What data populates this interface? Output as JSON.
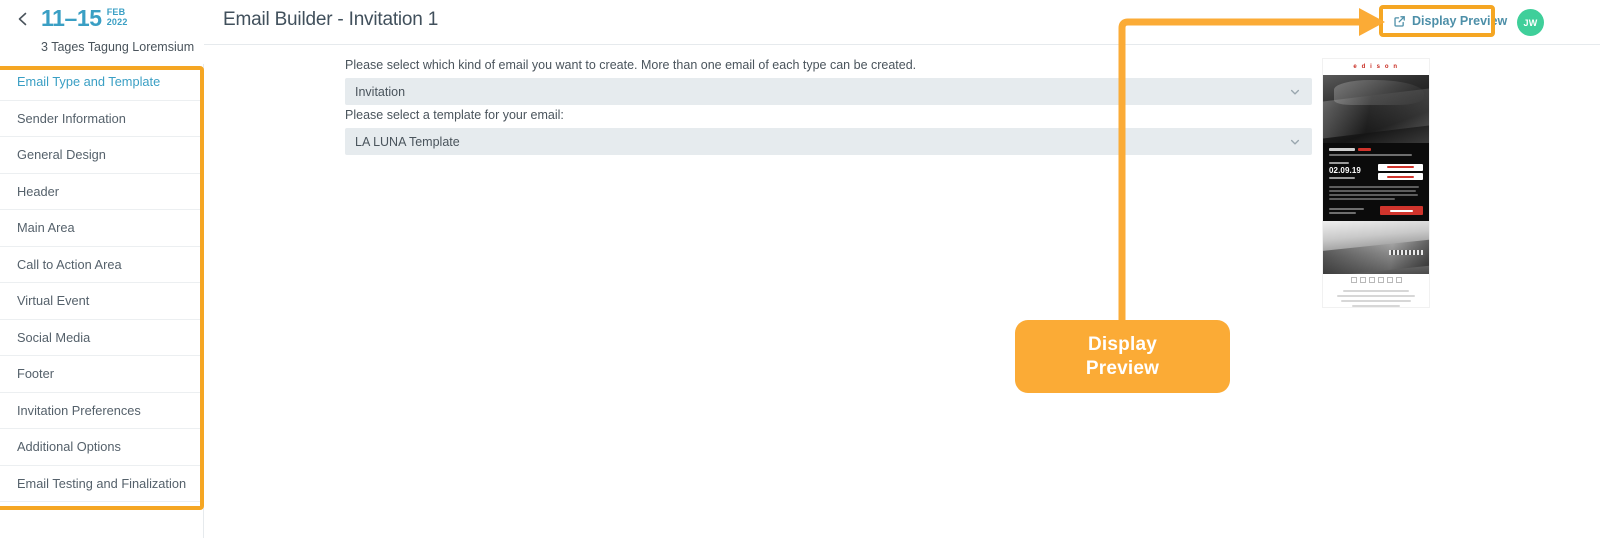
{
  "topbar": {
    "back_icon": "chevron-left-icon",
    "event": {
      "date_range": "11–15",
      "month": "FEB",
      "year": "2022",
      "subtitle": "3 Tages Tagung Loremsium"
    },
    "page_title": "Email Builder - Invitation 1",
    "display_preview": {
      "label": "Display Preview",
      "icon": "external-link-icon"
    },
    "avatar": {
      "initials": "JW",
      "color": "#3fcf9a"
    }
  },
  "sidebar": {
    "items": [
      {
        "label": "Email Type and Template",
        "active": true
      },
      {
        "label": "Sender Information",
        "active": false
      },
      {
        "label": "General Design",
        "active": false
      },
      {
        "label": "Header",
        "active": false
      },
      {
        "label": "Main Area",
        "active": false
      },
      {
        "label": "Call to Action Area",
        "active": false
      },
      {
        "label": "Virtual Event",
        "active": false
      },
      {
        "label": "Social Media",
        "active": false
      },
      {
        "label": "Footer",
        "active": false
      },
      {
        "label": "Invitation Preferences",
        "active": false
      },
      {
        "label": "Additional Options",
        "active": false
      },
      {
        "label": "Email Testing and Finalization",
        "active": false
      }
    ]
  },
  "main": {
    "email_type": {
      "label": "Please select which kind of email you want to create. More than one email of each type can be created.",
      "value": "Invitation",
      "chevron": "chevron-down-icon"
    },
    "template": {
      "label": "Please select a template for your email:",
      "value": "LA LUNA Template",
      "chevron": "chevron-down-icon"
    },
    "preview_thumbnail": {
      "brand": "e d i s o n",
      "date": "02.09.19"
    }
  },
  "annotation": {
    "callout_line1": "Display",
    "callout_line2": "Preview",
    "accent_color": "#f5a623",
    "callout_color": "#fbab36"
  }
}
